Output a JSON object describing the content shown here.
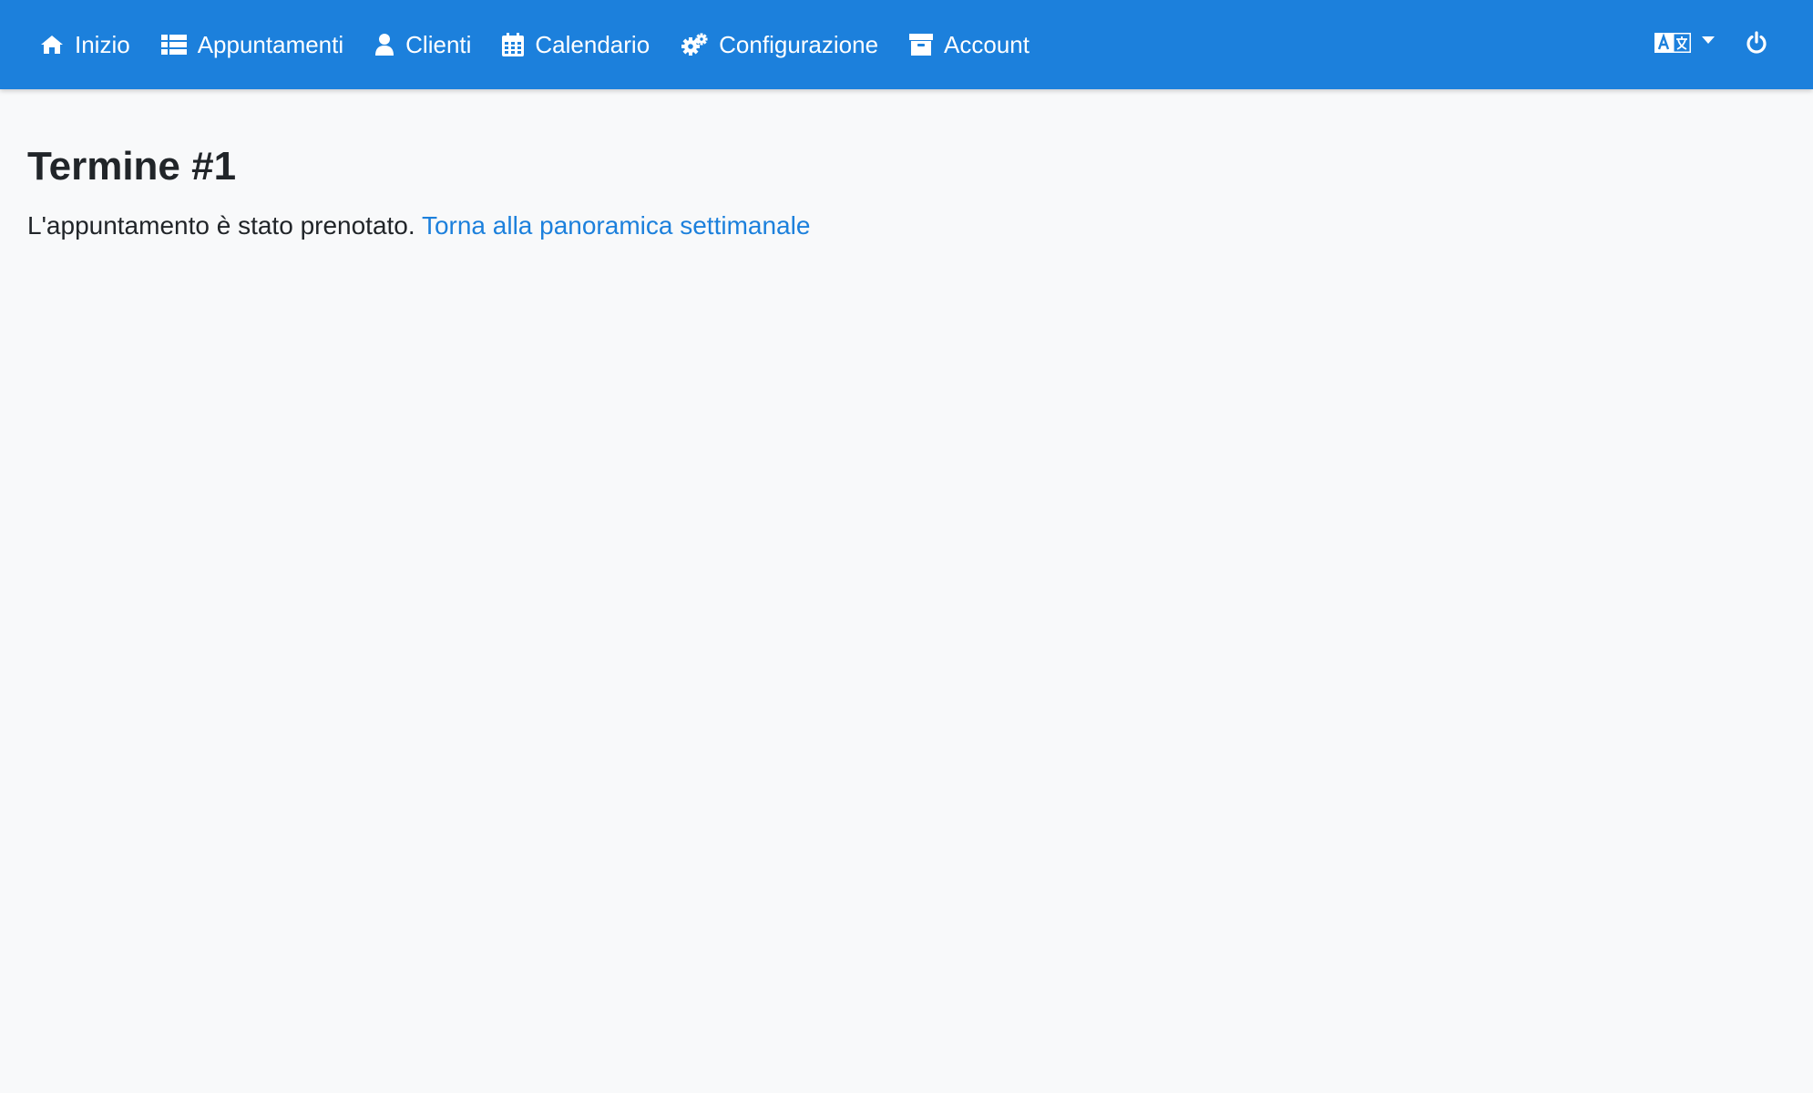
{
  "nav": {
    "items": [
      {
        "label": "Inizio",
        "icon": "home-icon"
      },
      {
        "label": "Appuntamenti",
        "icon": "list-icon"
      },
      {
        "label": "Clienti",
        "icon": "user-icon"
      },
      {
        "label": "Calendario",
        "icon": "calendar-icon"
      },
      {
        "label": "Configurazione",
        "icon": "cogs-icon"
      },
      {
        "label": "Account",
        "icon": "archive-icon"
      }
    ],
    "right": {
      "language_icon": "language-icon",
      "power_icon": "power-icon"
    }
  },
  "main": {
    "title": "Termine #1",
    "message": "L'appuntamento è stato prenotato.",
    "link_label": "Torna alla panoramica settimanale"
  },
  "colors": {
    "navbar": "#1c80dc",
    "background": "#f8f9fa",
    "link": "#1c80dc",
    "text": "#212529"
  }
}
